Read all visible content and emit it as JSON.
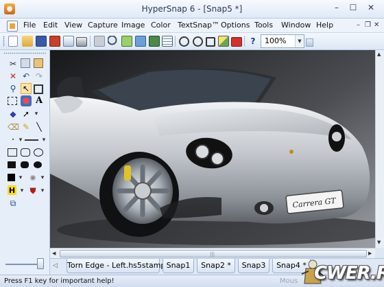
{
  "window": {
    "title": "HyperSnap 6 - [Snap5 *]",
    "controls": {
      "minimize": "–",
      "maximize": "☐",
      "close": "✕"
    }
  },
  "menubar": {
    "items": [
      "File",
      "Edit",
      "View",
      "Capture",
      "Image",
      "Color",
      "TextSnap™",
      "Options",
      "Tools",
      "Window",
      "Help"
    ],
    "mdi": {
      "minimize": "–",
      "restore": "❐",
      "close": "✕"
    }
  },
  "toolbar": {
    "zoom": {
      "value": "100%",
      "arrow": "▼"
    },
    "icons": [
      "new-icon",
      "open-icon",
      "save-icon",
      "save-all-icon",
      "print-preview-icon",
      "print-icon",
      "copy-icon",
      "find-icon",
      "capture-region-icon",
      "capture-window-icon",
      "capture-desktop-icon",
      "capture-menu-icon",
      "rotate-left-icon",
      "rotate-right-icon",
      "crop-icon",
      "resize-icon",
      "stamp-icon",
      "help-pointer-icon"
    ],
    "help_pointer": "?"
  },
  "toolbox": {
    "glyphs": {
      "scissors": "✂",
      "delete": "✕",
      "undo": "↶",
      "redo": "↷",
      "zoom": "⚲",
      "select": "↖",
      "text": "A",
      "pencil": "✎",
      "eraser": "⌫",
      "line": "╲",
      "heart": "♥",
      "arrow": "➚",
      "brush": "✐",
      "fill": "◆",
      "highlight": "H",
      "stamp": "⛊",
      "frame": "⧉",
      "dropdown": "▾"
    }
  },
  "scrollbars": {
    "left": "◀",
    "right": "▶",
    "up": "▲",
    "down": "▼",
    "grip": "|||"
  },
  "tabs": {
    "nav_prev": "◁",
    "items": [
      "Torn Edge - Left.hs5stamp",
      "Snap1",
      "Snap2 *",
      "Snap3",
      "Snap4 *"
    ]
  },
  "car": {
    "badge": "Carrera GT"
  },
  "statusbar": {
    "text": "Press F1 key for important help!",
    "mouse": "Mous"
  },
  "watermark": {
    "text": "CWER.RU"
  },
  "colors": {
    "accent": "#f0a33a",
    "chrome": "#d4e1f2",
    "selected_tool": "#fbe3a3"
  }
}
